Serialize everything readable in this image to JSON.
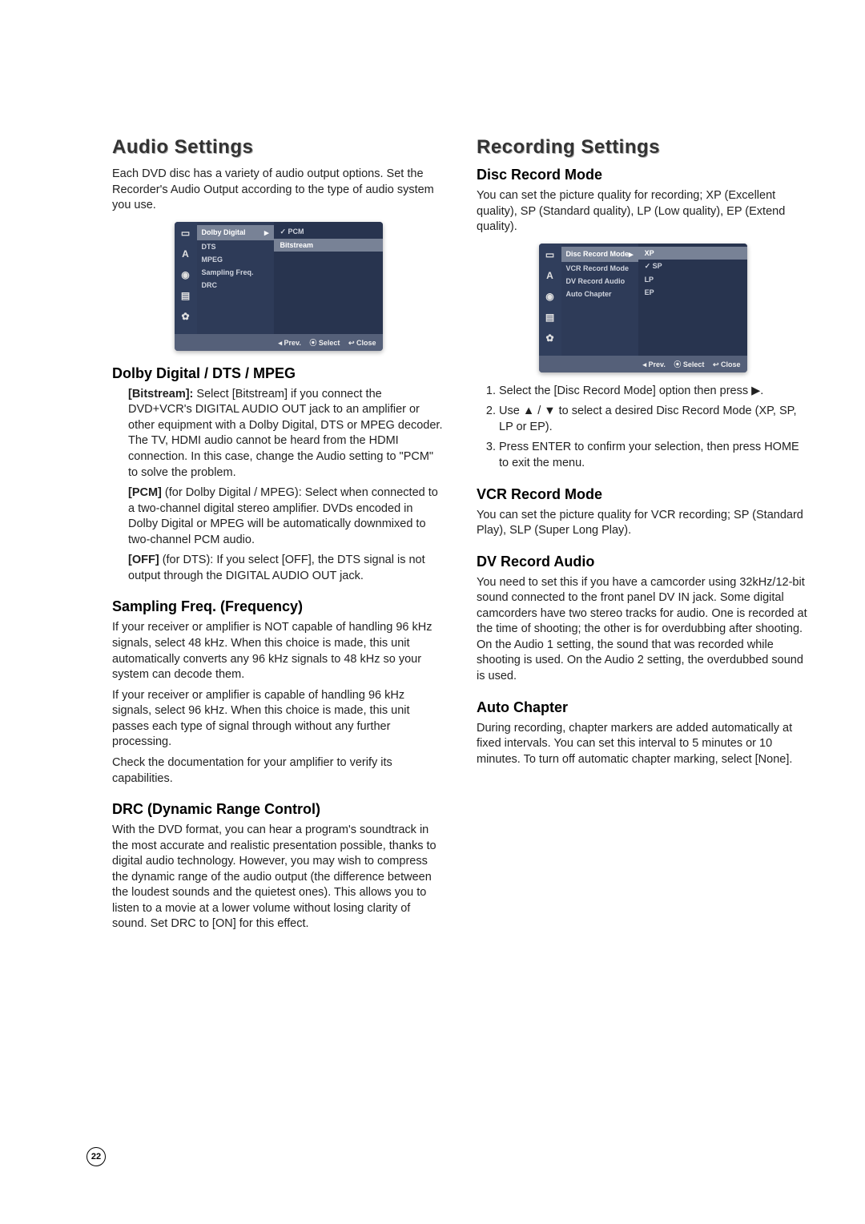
{
  "page_number": "22",
  "left": {
    "title": "Audio Settings",
    "intro": "Each DVD disc has a variety of audio output options. Set the Recorder's Audio Output according to the type of audio system you use.",
    "osd": {
      "menu": [
        "Dolby Digital",
        "DTS",
        "MPEG",
        "Sampling Freq.",
        "DRC"
      ],
      "menu_sel": "Dolby Digital",
      "opts": [
        "PCM",
        "Bitstream"
      ],
      "opts_checked": "PCM",
      "opts_hi": "Bitstream",
      "foot_prev": "◂ Prev.",
      "foot_select": "⦿ Select",
      "foot_close": "↩ Close"
    },
    "h_dolby": "Dolby Digital / DTS / MPEG",
    "bitstream_label": "[Bitstream]: ",
    "bitstream_body": "Select [Bitstream] if you connect the DVD+VCR's DIGITAL AUDIO OUT jack to an amplifier or other equipment with a Dolby Digital, DTS or MPEG decoder. The TV, HDMI audio cannot be heard from the HDMI connection. In this case, change the Audio setting to \"PCM\" to solve the problem.",
    "pcm_label": "[PCM] ",
    "pcm_body": "(for Dolby Digital / MPEG): Select when connected to a two-channel digital stereo amplifier. DVDs encoded in Dolby Digital or MPEG will be automatically downmixed to two-channel PCM audio.",
    "off_label": "[OFF] ",
    "off_body": "(for DTS): If you select [OFF], the DTS signal is not output through the DIGITAL AUDIO OUT jack.",
    "h_samp": "Sampling Freq. (Frequency)",
    "samp_p1": "If your receiver or amplifier is NOT capable of handling 96 kHz signals, select 48 kHz. When this choice is made, this unit automatically converts any 96 kHz signals to 48 kHz so your system can decode them.",
    "samp_p2": "If your receiver or amplifier is capable of handling 96 kHz signals, select 96 kHz. When this choice is made, this unit passes each type of signal through without any further processing.",
    "samp_p3": "Check the documentation for your amplifier to verify its capabilities.",
    "h_drc": "DRC (Dynamic Range Control)",
    "drc_p1": "With the DVD format, you can hear a program's soundtrack in the most accurate and realistic presentation possible, thanks to digital audio technology. However, you may wish to compress the dynamic range of the audio output (the difference between the loudest sounds and the quietest ones). This allows you to listen to a movie at a lower volume without losing clarity of sound. Set DRC to [ON] for this effect."
  },
  "right": {
    "title": "Recording Settings",
    "h_disc": "Disc Record Mode",
    "disc_p1": "You can set the picture quality for recording; XP (Excellent quality), SP (Standard quality), LP (Low quality), EP (Extend quality).",
    "osd": {
      "menu": [
        "Disc Record Mode",
        "VCR Record Mode",
        "DV Record Audio",
        "Auto Chapter"
      ],
      "menu_sel": "Disc Record Mode",
      "opts": [
        "XP",
        "SP",
        "LP",
        "EP"
      ],
      "opts_checked": "SP",
      "opts_hi": "XP",
      "foot_prev": "◂ Prev.",
      "foot_select": "⦿ Select",
      "foot_close": "↩ Close"
    },
    "step1": "Select the [Disc Record Mode] option then press ▶.",
    "step2": "Use ▲ / ▼ to select a desired Disc Record Mode (XP, SP, LP or EP).",
    "step3": "Press ENTER to confirm your selection, then press HOME to exit the menu.",
    "h_vcr": "VCR Record Mode",
    "vcr_p1": "You can set the picture quality for VCR recording; SP (Standard Play), SLP (Super Long Play).",
    "h_dvaudio": "DV Record Audio",
    "dvaudio_p1": "You need to set this if you have a camcorder using 32kHz/12-bit sound connected to the front panel DV IN jack. Some digital camcorders have two stereo tracks for audio. One is recorded at the time of shooting; the other is for overdubbing after shooting. On the Audio 1 setting, the sound that was recorded while shooting is used. On the Audio 2 setting, the overdubbed sound is used.",
    "h_auto": "Auto Chapter",
    "auto_p1": "During recording, chapter markers are added automatically at fixed intervals. You can set this interval to 5 minutes or 10 minutes. To turn off automatic chapter marking, select [None]."
  }
}
